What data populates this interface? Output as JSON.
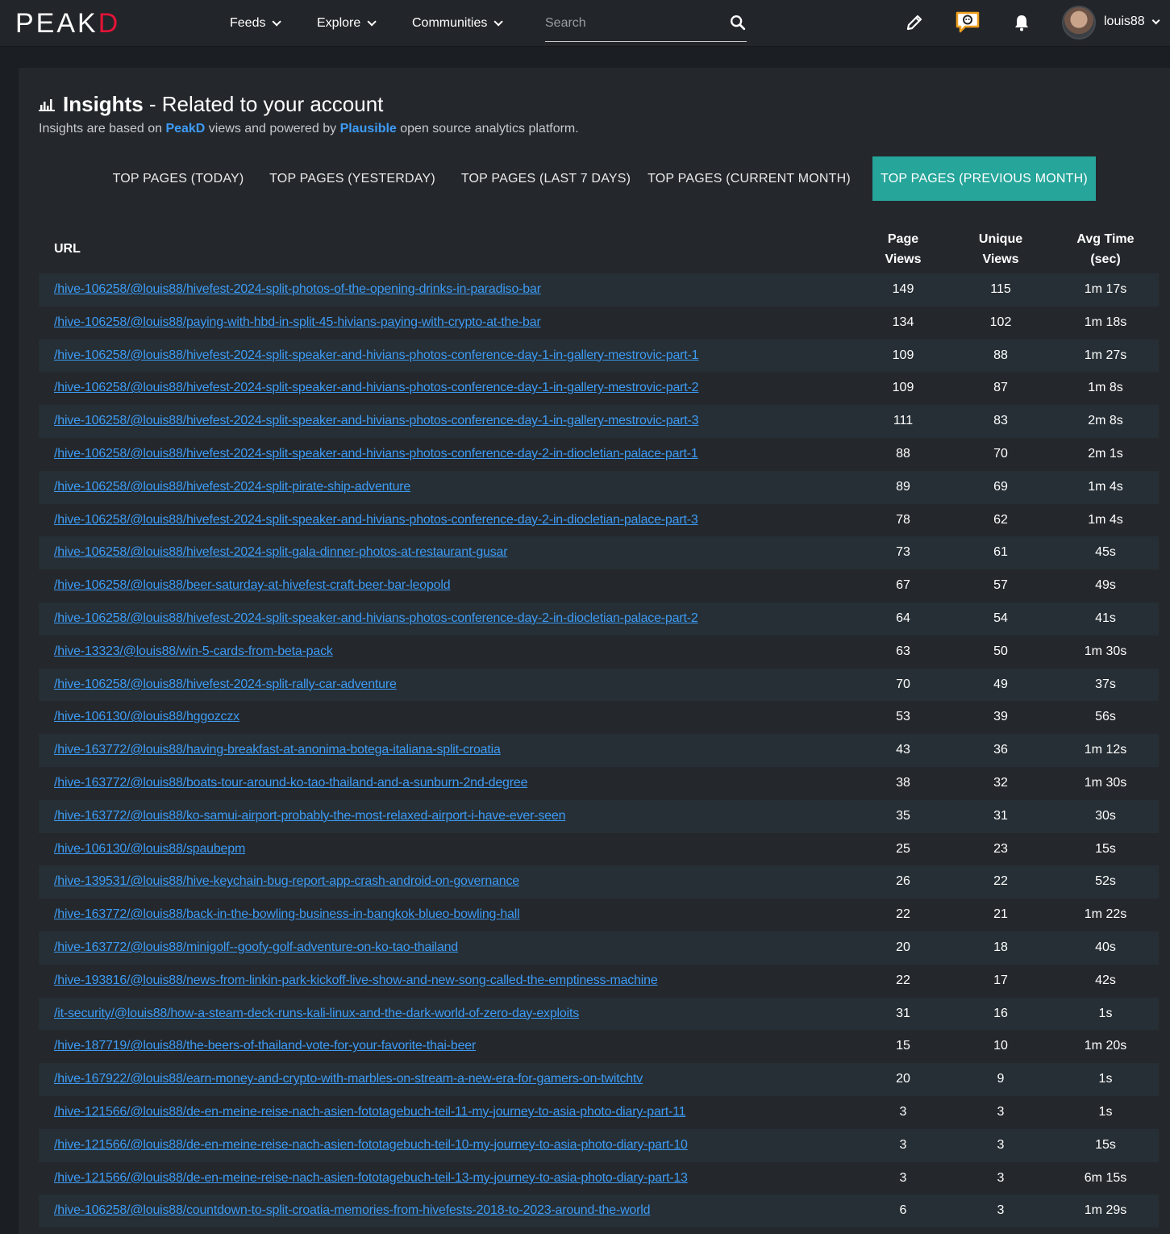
{
  "navbar": {
    "logo_main": "PEAK",
    "logo_accent": "D",
    "menu": [
      {
        "label": "Feeds"
      },
      {
        "label": "Explore"
      },
      {
        "label": "Communities"
      }
    ],
    "search": {
      "placeholder": "Search",
      "value": ""
    },
    "username": "louis88",
    "icons": [
      "pencil-icon",
      "chat-icon",
      "bell-icon",
      "search-icon"
    ]
  },
  "page": {
    "title_strong": "Insights",
    "title_rest": " - Related to your account",
    "subtitle_pre": "Insights are based on ",
    "subtitle_link1": "PeakD",
    "subtitle_mid": " views and powered by ",
    "subtitle_link2": "Plausible",
    "subtitle_post": " open source analytics platform."
  },
  "tabs": [
    {
      "label": "TOP PAGES (TODAY)",
      "active": false
    },
    {
      "label": "TOP PAGES (YESTERDAY)",
      "active": false
    },
    {
      "label": "TOP PAGES (LAST 7 DAYS)",
      "active": false
    },
    {
      "label": "TOP PAGES (CURRENT MONTH)",
      "active": false
    },
    {
      "label": "TOP PAGES (PREVIOUS MONTH)",
      "active": true
    }
  ],
  "table": {
    "headers": {
      "url": "URL",
      "page_views_1": "Page",
      "page_views_2": "Views",
      "unique_views_1": "Unique",
      "unique_views_2": "Views",
      "avg_time_1": "Avg Time",
      "avg_time_2": "(sec)"
    },
    "rows": [
      {
        "url": "/hive-106258/@louis88/hivefest-2024-split-photos-of-the-opening-drinks-in-paradiso-bar",
        "page_views": "149",
        "unique_views": "115",
        "avg_time": "1m 17s"
      },
      {
        "url": "/hive-106258/@louis88/paying-with-hbd-in-split-45-hivians-paying-with-crypto-at-the-bar",
        "page_views": "134",
        "unique_views": "102",
        "avg_time": "1m 18s"
      },
      {
        "url": "/hive-106258/@louis88/hivefest-2024-split-speaker-and-hivians-photos-conference-day-1-in-gallery-mestrovic-part-1",
        "page_views": "109",
        "unique_views": "88",
        "avg_time": "1m 27s"
      },
      {
        "url": "/hive-106258/@louis88/hivefest-2024-split-speaker-and-hivians-photos-conference-day-1-in-gallery-mestrovic-part-2",
        "page_views": "109",
        "unique_views": "87",
        "avg_time": "1m 8s"
      },
      {
        "url": "/hive-106258/@louis88/hivefest-2024-split-speaker-and-hivians-photos-conference-day-1-in-gallery-mestrovic-part-3",
        "page_views": "111",
        "unique_views": "83",
        "avg_time": "2m 8s"
      },
      {
        "url": "/hive-106258/@louis88/hivefest-2024-split-speaker-and-hivians-photos-conference-day-2-in-diocletian-palace-part-1",
        "page_views": "88",
        "unique_views": "70",
        "avg_time": "2m 1s"
      },
      {
        "url": "/hive-106258/@louis88/hivefest-2024-split-pirate-ship-adventure",
        "page_views": "89",
        "unique_views": "69",
        "avg_time": "1m 4s"
      },
      {
        "url": "/hive-106258/@louis88/hivefest-2024-split-speaker-and-hivians-photos-conference-day-2-in-diocletian-palace-part-3",
        "page_views": "78",
        "unique_views": "62",
        "avg_time": "1m 4s"
      },
      {
        "url": "/hive-106258/@louis88/hivefest-2024-split-gala-dinner-photos-at-restaurant-gusar",
        "page_views": "73",
        "unique_views": "61",
        "avg_time": "45s"
      },
      {
        "url": "/hive-106258/@louis88/beer-saturday-at-hivefest-craft-beer-bar-leopold",
        "page_views": "67",
        "unique_views": "57",
        "avg_time": "49s"
      },
      {
        "url": "/hive-106258/@louis88/hivefest-2024-split-speaker-and-hivians-photos-conference-day-2-in-diocletian-palace-part-2",
        "page_views": "64",
        "unique_views": "54",
        "avg_time": "41s"
      },
      {
        "url": "/hive-13323/@louis88/win-5-cards-from-beta-pack",
        "page_views": "63",
        "unique_views": "50",
        "avg_time": "1m 30s"
      },
      {
        "url": "/hive-106258/@louis88/hivefest-2024-split-rally-car-adventure",
        "page_views": "70",
        "unique_views": "49",
        "avg_time": "37s"
      },
      {
        "url": "/hive-106130/@louis88/hggozczx",
        "page_views": "53",
        "unique_views": "39",
        "avg_time": "56s"
      },
      {
        "url": "/hive-163772/@louis88/having-breakfast-at-anonima-botega-italiana-split-croatia",
        "page_views": "43",
        "unique_views": "36",
        "avg_time": "1m 12s"
      },
      {
        "url": "/hive-163772/@louis88/boats-tour-around-ko-tao-thailand-and-a-sunburn-2nd-degree",
        "page_views": "38",
        "unique_views": "32",
        "avg_time": "1m 30s"
      },
      {
        "url": "/hive-163772/@louis88/ko-samui-airport-probably-the-most-relaxed-airport-i-have-ever-seen",
        "page_views": "35",
        "unique_views": "31",
        "avg_time": "30s"
      },
      {
        "url": "/hive-106130/@louis88/spaubepm",
        "page_views": "25",
        "unique_views": "23",
        "avg_time": "15s"
      },
      {
        "url": "/hive-139531/@louis88/hive-keychain-bug-report-app-crash-android-on-governance",
        "page_views": "26",
        "unique_views": "22",
        "avg_time": "52s"
      },
      {
        "url": "/hive-163772/@louis88/back-in-the-bowling-business-in-bangkok-blueo-bowling-hall",
        "page_views": "22",
        "unique_views": "21",
        "avg_time": "1m 22s"
      },
      {
        "url": "/hive-163772/@louis88/minigolf--goofy-golf-adventure-on-ko-tao-thailand",
        "page_views": "20",
        "unique_views": "18",
        "avg_time": "40s"
      },
      {
        "url": "/hive-193816/@louis88/news-from-linkin-park-kickoff-live-show-and-new-song-called-the-emptiness-machine",
        "page_views": "22",
        "unique_views": "17",
        "avg_time": "42s"
      },
      {
        "url": "/it-security/@louis88/how-a-steam-deck-runs-kali-linux-and-the-dark-world-of-zero-day-exploits",
        "page_views": "31",
        "unique_views": "16",
        "avg_time": "1s"
      },
      {
        "url": "/hive-187719/@louis88/the-beers-of-thailand-vote-for-your-favorite-thai-beer",
        "page_views": "15",
        "unique_views": "10",
        "avg_time": "1m 20s"
      },
      {
        "url": "/hive-167922/@louis88/earn-money-and-crypto-with-marbles-on-stream-a-new-era-for-gamers-on-twitchtv",
        "page_views": "20",
        "unique_views": "9",
        "avg_time": "1s"
      },
      {
        "url": "/hive-121566/@louis88/de-en-meine-reise-nach-asien-fototagebuch-teil-11-my-journey-to-asia-photo-diary-part-11",
        "page_views": "3",
        "unique_views": "3",
        "avg_time": "1s"
      },
      {
        "url": "/hive-121566/@louis88/de-en-meine-reise-nach-asien-fototagebuch-teil-10-my-journey-to-asia-photo-diary-part-10",
        "page_views": "3",
        "unique_views": "3",
        "avg_time": "15s"
      },
      {
        "url": "/hive-121566/@louis88/de-en-meine-reise-nach-asien-fototagebuch-teil-13-my-journey-to-asia-photo-diary-part-13",
        "page_views": "3",
        "unique_views": "3",
        "avg_time": "6m 15s"
      },
      {
        "url": "/hive-106258/@louis88/countdown-to-split-croatia-memories-from-hivefests-2018-to-2023-around-the-world",
        "page_views": "6",
        "unique_views": "3",
        "avg_time": "1m 29s"
      }
    ]
  }
}
